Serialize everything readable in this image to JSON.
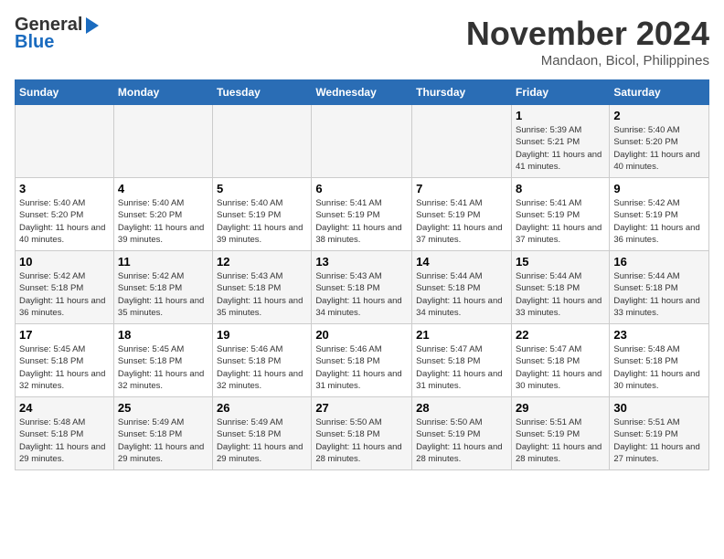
{
  "header": {
    "logo_line1": "General",
    "logo_line2": "Blue",
    "month": "November 2024",
    "location": "Mandaon, Bicol, Philippines"
  },
  "weekdays": [
    "Sunday",
    "Monday",
    "Tuesday",
    "Wednesday",
    "Thursday",
    "Friday",
    "Saturday"
  ],
  "rows": [
    [
      {
        "day": "",
        "info": ""
      },
      {
        "day": "",
        "info": ""
      },
      {
        "day": "",
        "info": ""
      },
      {
        "day": "",
        "info": ""
      },
      {
        "day": "",
        "info": ""
      },
      {
        "day": "1",
        "info": "Sunrise: 5:39 AM\nSunset: 5:21 PM\nDaylight: 11 hours and 41 minutes."
      },
      {
        "day": "2",
        "info": "Sunrise: 5:40 AM\nSunset: 5:20 PM\nDaylight: 11 hours and 40 minutes."
      }
    ],
    [
      {
        "day": "3",
        "info": "Sunrise: 5:40 AM\nSunset: 5:20 PM\nDaylight: 11 hours and 40 minutes."
      },
      {
        "day": "4",
        "info": "Sunrise: 5:40 AM\nSunset: 5:20 PM\nDaylight: 11 hours and 39 minutes."
      },
      {
        "day": "5",
        "info": "Sunrise: 5:40 AM\nSunset: 5:19 PM\nDaylight: 11 hours and 39 minutes."
      },
      {
        "day": "6",
        "info": "Sunrise: 5:41 AM\nSunset: 5:19 PM\nDaylight: 11 hours and 38 minutes."
      },
      {
        "day": "7",
        "info": "Sunrise: 5:41 AM\nSunset: 5:19 PM\nDaylight: 11 hours and 37 minutes."
      },
      {
        "day": "8",
        "info": "Sunrise: 5:41 AM\nSunset: 5:19 PM\nDaylight: 11 hours and 37 minutes."
      },
      {
        "day": "9",
        "info": "Sunrise: 5:42 AM\nSunset: 5:19 PM\nDaylight: 11 hours and 36 minutes."
      }
    ],
    [
      {
        "day": "10",
        "info": "Sunrise: 5:42 AM\nSunset: 5:18 PM\nDaylight: 11 hours and 36 minutes."
      },
      {
        "day": "11",
        "info": "Sunrise: 5:42 AM\nSunset: 5:18 PM\nDaylight: 11 hours and 35 minutes."
      },
      {
        "day": "12",
        "info": "Sunrise: 5:43 AM\nSunset: 5:18 PM\nDaylight: 11 hours and 35 minutes."
      },
      {
        "day": "13",
        "info": "Sunrise: 5:43 AM\nSunset: 5:18 PM\nDaylight: 11 hours and 34 minutes."
      },
      {
        "day": "14",
        "info": "Sunrise: 5:44 AM\nSunset: 5:18 PM\nDaylight: 11 hours and 34 minutes."
      },
      {
        "day": "15",
        "info": "Sunrise: 5:44 AM\nSunset: 5:18 PM\nDaylight: 11 hours and 33 minutes."
      },
      {
        "day": "16",
        "info": "Sunrise: 5:44 AM\nSunset: 5:18 PM\nDaylight: 11 hours and 33 minutes."
      }
    ],
    [
      {
        "day": "17",
        "info": "Sunrise: 5:45 AM\nSunset: 5:18 PM\nDaylight: 11 hours and 32 minutes."
      },
      {
        "day": "18",
        "info": "Sunrise: 5:45 AM\nSunset: 5:18 PM\nDaylight: 11 hours and 32 minutes."
      },
      {
        "day": "19",
        "info": "Sunrise: 5:46 AM\nSunset: 5:18 PM\nDaylight: 11 hours and 32 minutes."
      },
      {
        "day": "20",
        "info": "Sunrise: 5:46 AM\nSunset: 5:18 PM\nDaylight: 11 hours and 31 minutes."
      },
      {
        "day": "21",
        "info": "Sunrise: 5:47 AM\nSunset: 5:18 PM\nDaylight: 11 hours and 31 minutes."
      },
      {
        "day": "22",
        "info": "Sunrise: 5:47 AM\nSunset: 5:18 PM\nDaylight: 11 hours and 30 minutes."
      },
      {
        "day": "23",
        "info": "Sunrise: 5:48 AM\nSunset: 5:18 PM\nDaylight: 11 hours and 30 minutes."
      }
    ],
    [
      {
        "day": "24",
        "info": "Sunrise: 5:48 AM\nSunset: 5:18 PM\nDaylight: 11 hours and 29 minutes."
      },
      {
        "day": "25",
        "info": "Sunrise: 5:49 AM\nSunset: 5:18 PM\nDaylight: 11 hours and 29 minutes."
      },
      {
        "day": "26",
        "info": "Sunrise: 5:49 AM\nSunset: 5:18 PM\nDaylight: 11 hours and 29 minutes."
      },
      {
        "day": "27",
        "info": "Sunrise: 5:50 AM\nSunset: 5:18 PM\nDaylight: 11 hours and 28 minutes."
      },
      {
        "day": "28",
        "info": "Sunrise: 5:50 AM\nSunset: 5:19 PM\nDaylight: 11 hours and 28 minutes."
      },
      {
        "day": "29",
        "info": "Sunrise: 5:51 AM\nSunset: 5:19 PM\nDaylight: 11 hours and 28 minutes."
      },
      {
        "day": "30",
        "info": "Sunrise: 5:51 AM\nSunset: 5:19 PM\nDaylight: 11 hours and 27 minutes."
      }
    ]
  ]
}
